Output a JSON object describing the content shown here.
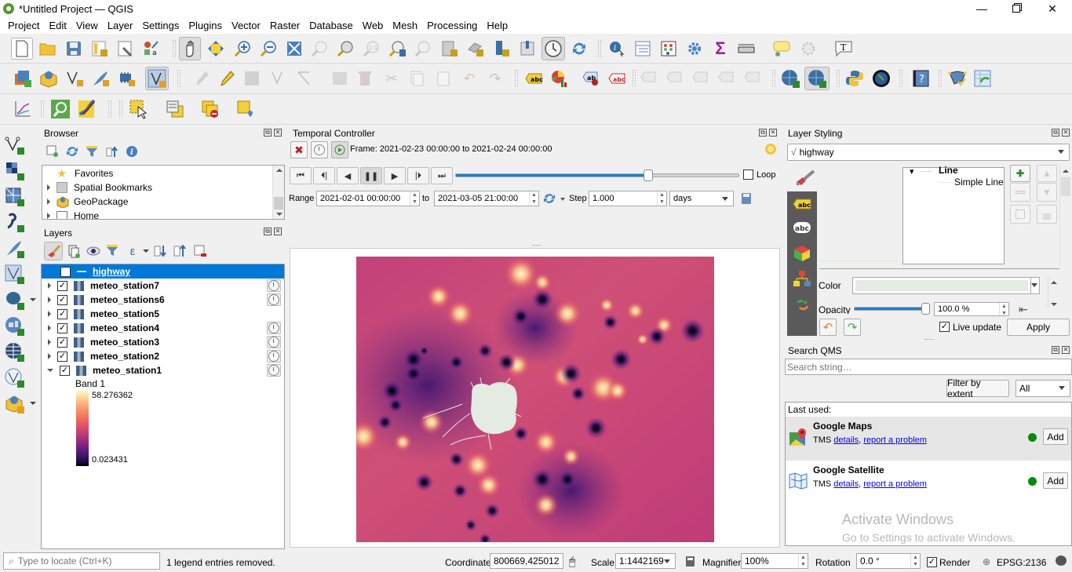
{
  "window": {
    "title": "*Untitled Project — QGIS",
    "controls": [
      "minimize",
      "restore",
      "close"
    ]
  },
  "menubar": [
    "Project",
    "Edit",
    "View",
    "Layer",
    "Settings",
    "Plugins",
    "Vector",
    "Raster",
    "Database",
    "Web",
    "Mesh",
    "Processing",
    "Help"
  ],
  "toolbars": {
    "row1": [
      "new-project-icon",
      "open-project-icon",
      "save-project-icon",
      "new-print-layout-icon",
      "layout-manager-icon",
      "style-manager-icon",
      "pan-icon",
      "pan-to-selection-icon",
      "zoom-in-icon",
      "zoom-out-icon",
      "zoom-full-icon",
      "zoom-to-selection-icon",
      "zoom-to-layer-icon",
      "zoom-native-icon",
      "zoom-last-icon",
      "zoom-next-icon",
      "new-map-view-icon",
      "new-3d-map-icon",
      "new-bookmark-icon",
      "show-bookmarks-icon",
      "temporal-controller-icon",
      "refresh-icon",
      "identify-icon",
      "attribute-table-icon",
      "field-calculator-icon",
      "processing-toolbox-icon",
      "statistics-icon",
      "measure-icon",
      "map-tips-icon",
      "run-action-icon",
      "text-annotation-icon"
    ],
    "row2": [
      "data-source-manager-icon",
      "new-geopackage-layer-icon",
      "new-shapefile-layer-icon",
      "new-temporary-scratch-layer-icon",
      "new-virtual-layer-icon",
      "digitize-vertex-icon",
      "current-edits-icon",
      "toggle-editing-icon",
      "save-edits-icon",
      "vertex-tool-icon",
      "digitize-options-icon",
      "modify-attributes-icon",
      "delete-selected-icon",
      "cut-features-icon",
      "copy-features-icon",
      "paste-features-icon",
      "undo-icon",
      "redo-icon",
      "label-toolbar-icon",
      "diagram-icon",
      "pin-labels-icon",
      "highlight-pinned-labels-icon",
      "show-hide-labels-icon",
      "move-label-icon",
      "rotate-label-icon",
      "change-label-icon",
      "label-disabled-icon",
      "add-qms-icon",
      "search-qms-icon",
      "python-console-icon",
      "globe-icon",
      "help-icon",
      "topology-checker-icon",
      "refresh-table-icon"
    ],
    "row3": [
      "profile-tool-icon",
      "locator-search-icon",
      "georeferencer-icon",
      "select-features-icon",
      "select-by-attribute-icon",
      "deselect-icon",
      "add-point-icon"
    ]
  },
  "left_toolbar": [
    "add-vector-layer-icon",
    "add-raster-layer-icon",
    "add-mesh-layer-icon",
    "add-delimited-text-icon",
    "add-spatialite-layer-icon",
    "add-virtual-layer-icon",
    "add-postgis-layer-icon",
    "add-wms-layer-icon",
    "add-wcs-layer-icon",
    "add-wfs-layer-icon",
    "add-geopackage-icon"
  ],
  "browser": {
    "title": "Browser",
    "items": [
      {
        "label": "Favorites",
        "icon": "star-icon",
        "expandable": false
      },
      {
        "label": "Spatial Bookmarks",
        "icon": "bookmark-icon",
        "expandable": true
      },
      {
        "label": "GeoPackage",
        "icon": "geopackage-icon",
        "expandable": true
      },
      {
        "label": "Home",
        "icon": "home-folder-icon",
        "expandable": true
      }
    ]
  },
  "layers": {
    "title": "Layers",
    "items": [
      {
        "name": "highway",
        "checked": true,
        "selected": true,
        "temporal": false,
        "type": "line"
      },
      {
        "name": "meteo_station7",
        "checked": true,
        "temporal": true,
        "type": "raster"
      },
      {
        "name": "meteo_stations6",
        "checked": true,
        "temporal": true,
        "type": "raster"
      },
      {
        "name": "meteo_station5",
        "checked": true,
        "temporal": false,
        "type": "raster"
      },
      {
        "name": "meteo_station4",
        "checked": true,
        "temporal": true,
        "type": "raster"
      },
      {
        "name": "meteo_station3",
        "checked": true,
        "temporal": true,
        "type": "raster"
      },
      {
        "name": "meteo_station2",
        "checked": true,
        "temporal": true,
        "type": "raster"
      },
      {
        "name": "meteo_station1",
        "checked": true,
        "temporal": true,
        "type": "raster",
        "expanded": true
      }
    ],
    "legend": {
      "band": "Band 1",
      "max": "58.276362",
      "min": "0.023431"
    }
  },
  "temporal": {
    "title": "Temporal Controller",
    "frame_text": "Frame: 2021-02-23 00:00:00 to 2021-02-24 00:00:00",
    "slider_fraction": 0.68,
    "loop_label": "Loop",
    "loop_checked": false,
    "range_label": "Range",
    "range_start": "2021-02-01 00:00:00",
    "to_label": "to",
    "range_end": "2021-03-05 21:00:00",
    "step_label": "Step",
    "step_value": "1.000",
    "step_unit": "days"
  },
  "styling": {
    "title": "Layer Styling",
    "layer": "highway",
    "symbol_tree": [
      "Line",
      "Simple Line"
    ],
    "color_label": "Color",
    "color_value": "#e3ebe3",
    "opacity_label": "Opacity",
    "opacity_value": "100.0 %",
    "opacity_fraction": 1.0,
    "live_update_label": "Live update",
    "live_update_checked": true,
    "apply_label": "Apply"
  },
  "qms": {
    "title": "Search QMS",
    "search_placeholder": "Search string…",
    "filter_button": "Filter by extent",
    "filter_option": "All",
    "last_used_label": "Last used:",
    "services": [
      {
        "name": "Google Maps",
        "type": "TMS",
        "details": "details",
        "report": "report a problem",
        "add": "Add",
        "status_color": "#0a8a0a"
      },
      {
        "name": "Google Satellite",
        "type": "TMS",
        "details": "details",
        "report": "report a problem",
        "add": "Add",
        "status_color": "#0a8a0a"
      }
    ],
    "watermark_title": "Activate Windows",
    "watermark_sub": "Go to Settings to activate Windows."
  },
  "status": {
    "locator_placeholder": "Type to locate (Ctrl+K)",
    "message": "1 legend entries removed.",
    "coordinate_label": "Coordinate",
    "coordinate_value": "800669,425012",
    "scale_label": "Scale",
    "scale_value": "1:1442169",
    "magnifier_label": "Magnifier",
    "magnifier_value": "100%",
    "rotation_label": "Rotation",
    "rotation_value": "0.0 °",
    "render_label": "Render",
    "render_checked": true,
    "crs": "EPSG:2136"
  },
  "colors": {
    "selection": "#0078d7",
    "map_base": "#c0407a",
    "highway": "#e3ebe3"
  }
}
